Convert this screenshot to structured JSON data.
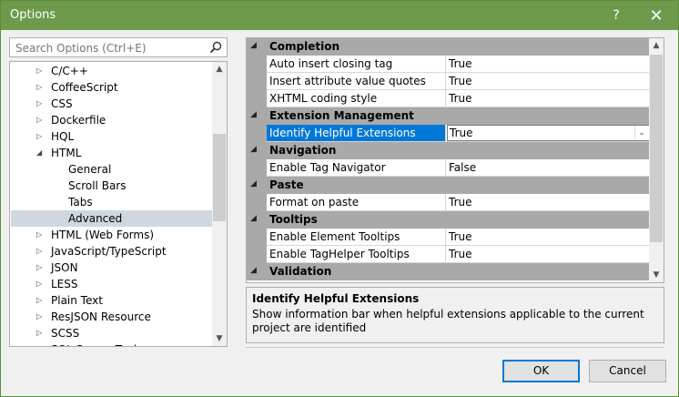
{
  "window": {
    "title": "Options",
    "help": "?",
    "close": "✕"
  },
  "search": {
    "placeholder": "Search Options (Ctrl+E)"
  },
  "tree": [
    {
      "label": "C/C++",
      "arrow": "▷",
      "indent": 0
    },
    {
      "label": "CoffeeScript",
      "arrow": "▷",
      "indent": 0
    },
    {
      "label": "CSS",
      "arrow": "▷",
      "indent": 0
    },
    {
      "label": "Dockerfile",
      "arrow": "▷",
      "indent": 0
    },
    {
      "label": "HQL",
      "arrow": "▷",
      "indent": 0
    },
    {
      "label": "HTML",
      "arrow": "◢",
      "indent": 0
    },
    {
      "label": "General",
      "arrow": "",
      "indent": 1
    },
    {
      "label": "Scroll Bars",
      "arrow": "",
      "indent": 1
    },
    {
      "label": "Tabs",
      "arrow": "",
      "indent": 1
    },
    {
      "label": "Advanced",
      "arrow": "",
      "indent": 1,
      "selected": true
    },
    {
      "label": "HTML (Web Forms)",
      "arrow": "▷",
      "indent": 0
    },
    {
      "label": "JavaScript/TypeScript",
      "arrow": "▷",
      "indent": 0
    },
    {
      "label": "JSON",
      "arrow": "▷",
      "indent": 0
    },
    {
      "label": "LESS",
      "arrow": "▷",
      "indent": 0
    },
    {
      "label": "Plain Text",
      "arrow": "▷",
      "indent": 0
    },
    {
      "label": "ResJSON Resource",
      "arrow": "▷",
      "indent": 0
    },
    {
      "label": "SCSS",
      "arrow": "▷",
      "indent": 0
    },
    {
      "label": "SQL Server Tools",
      "arrow": "▷",
      "indent": 0
    }
  ],
  "grid": [
    {
      "type": "cat",
      "label": "Completion"
    },
    {
      "type": "prop",
      "name": "Auto insert closing tag",
      "value": "True"
    },
    {
      "type": "prop",
      "name": "Insert attribute value quotes",
      "value": "True"
    },
    {
      "type": "prop",
      "name": "XHTML coding style",
      "value": "True"
    },
    {
      "type": "cat",
      "label": "Extension Management"
    },
    {
      "type": "prop",
      "name": "Identify Helpful Extensions",
      "value": "True",
      "selected": true
    },
    {
      "type": "cat",
      "label": "Navigation"
    },
    {
      "type": "prop",
      "name": "Enable Tag Navigator",
      "value": "False"
    },
    {
      "type": "cat",
      "label": "Paste"
    },
    {
      "type": "prop",
      "name": "Format on paste",
      "value": "True"
    },
    {
      "type": "cat",
      "label": "Tooltips"
    },
    {
      "type": "prop",
      "name": "Enable Element Tooltips",
      "value": "True"
    },
    {
      "type": "prop",
      "name": "Enable TagHelper Tooltips",
      "value": "True"
    },
    {
      "type": "cat",
      "label": "Validation"
    }
  ],
  "description": {
    "title": "Identify Helpful Extensions",
    "text": "Show information bar when helpful extensions applicable to the current project are identified"
  },
  "buttons": {
    "ok": "OK",
    "cancel": "Cancel"
  },
  "colors": {
    "titlebar": "#6e9a4b",
    "selection": "#0078d7",
    "category": "#a9a9a9",
    "tree_selection": "#cfd8e0"
  }
}
